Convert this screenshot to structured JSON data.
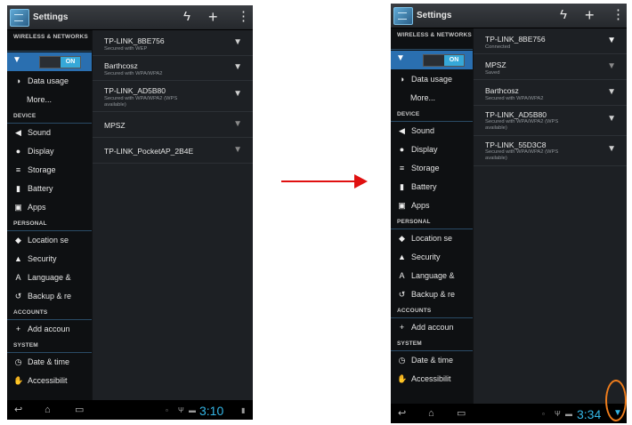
{
  "left": {
    "title": "Settings",
    "clock": "3:10",
    "categories": {
      "wireless": "WIRELESS & NETWORKS",
      "device": "DEVICE",
      "personal": "PERSONAL",
      "accounts": "ACCOUNTS",
      "system": "SYSTEM"
    },
    "wifi_toggle": "ON",
    "items": {
      "data_usage": "Data usage",
      "more": "More...",
      "sound": "Sound",
      "display": "Display",
      "storage": "Storage",
      "battery": "Battery",
      "apps": "Apps",
      "location": "Location se",
      "security": "Security",
      "language": "Language &",
      "backup": "Backup & re",
      "add_account": "Add accoun",
      "date_time": "Date & time",
      "accessibility": "Accessibilit"
    },
    "networks": [
      {
        "name": "TP-LINK_8BE756",
        "status": "Secured with WEP"
      },
      {
        "name": "Barthcosz",
        "status": "Secured with WPA/WPA2"
      },
      {
        "name": "TP-LINK_AD5B80",
        "status": "Secured with WPA/WPA2 (WPS available)"
      },
      {
        "name": "MPSZ",
        "status": ""
      },
      {
        "name": "TP-LINK_PocketAP_2B4E",
        "status": ""
      }
    ]
  },
  "right": {
    "title": "Settings",
    "clock": "3:34",
    "categories": {
      "wireless": "WIRELESS & NETWORKS",
      "device": "DEVICE",
      "personal": "PERSONAL",
      "accounts": "ACCOUNTS",
      "system": "SYSTEM"
    },
    "wifi_toggle": "ON",
    "items": {
      "data_usage": "Data usage",
      "more": "More...",
      "sound": "Sound",
      "display": "Display",
      "storage": "Storage",
      "battery": "Battery",
      "apps": "Apps",
      "location": "Location se",
      "security": "Security",
      "language": "Language &",
      "backup": "Backup & re",
      "add_account": "Add accoun",
      "date_time": "Date & time",
      "accessibility": "Accessibilit"
    },
    "networks": [
      {
        "name": "TP-LINK_8BE756",
        "status": "Connected"
      },
      {
        "name": "MPSZ",
        "status": "Saved"
      },
      {
        "name": "Barthcosz",
        "status": "Secured with WPA/WPA2"
      },
      {
        "name": "TP-LINK_AD5B80",
        "status": "Secured with WPA/WPA2 (WPS available)"
      },
      {
        "name": "TP-LINK_55D3C8",
        "status": "Secured with WPA/WPA2 (WPS available)"
      }
    ]
  },
  "icons": {
    "wifi": "wifi-icon",
    "refresh": "wps-icon",
    "add": "add-network-icon",
    "overflow": "overflow-menu-icon",
    "back": "back-icon",
    "home": "home-icon",
    "recents": "recent-apps-icon"
  },
  "colors": {
    "accent": "#33b5e5",
    "selected_row": "#2a6fb0",
    "arrow": "#e01010",
    "highlight": "#ef7d1c"
  }
}
